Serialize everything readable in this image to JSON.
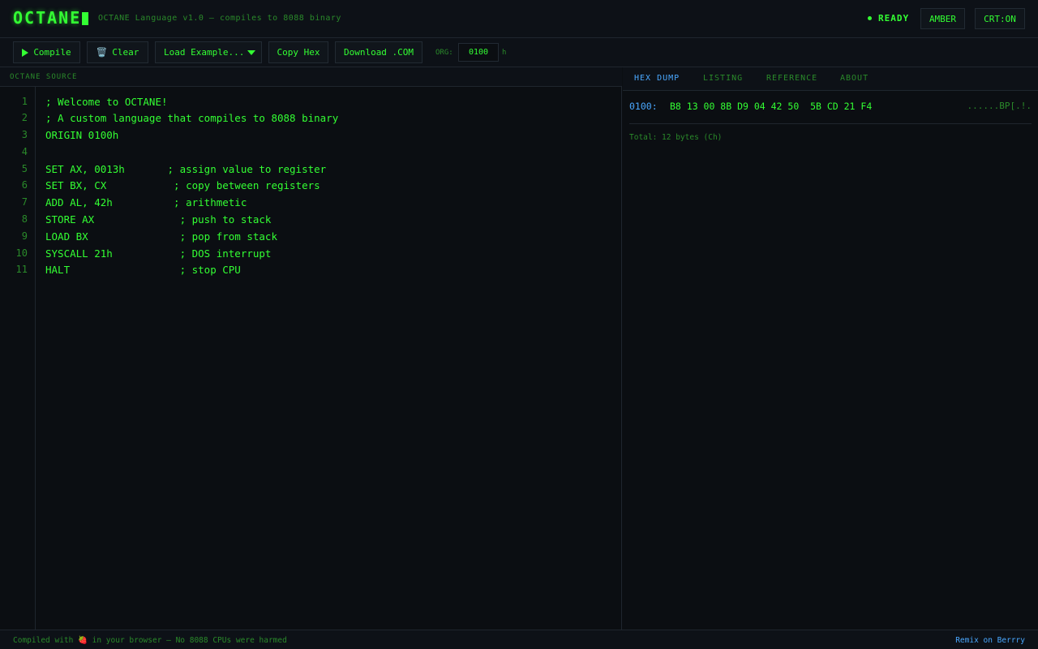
{
  "header": {
    "logo": "OCTANE",
    "subtitle": "OCTANE Language v1.0 — compiles to 8088 binary",
    "status": "READY",
    "amber_label": "AMBER",
    "crt_label": "CRT:ON"
  },
  "toolbar": {
    "compile_label": "Compile",
    "clear_label": "Clear",
    "load_example_label": "Load Example...",
    "copy_hex_label": "Copy Hex",
    "download_label": "Download .COM",
    "org_label": "ORG:",
    "org_value": "0100",
    "org_suffix": "h"
  },
  "editor": {
    "title": "OCTANE SOURCE",
    "lines": [
      "; Welcome to OCTANE!",
      "; A custom language that compiles to 8088 binary",
      "ORIGIN 0100h",
      "",
      "SET AX, 0013h       ; assign value to register",
      "SET BX, CX           ; copy between registers",
      "ADD AL, 42h          ; arithmetic",
      "STORE AX              ; push to stack",
      "LOAD BX               ; pop from stack",
      "SYSCALL 21h           ; DOS interrupt",
      "HALT                  ; stop CPU"
    ],
    "line_numbers": [
      "1",
      "2",
      "3",
      "4",
      "5",
      "6",
      "7",
      "8",
      "9",
      "10",
      "11"
    ]
  },
  "output": {
    "tabs": [
      "HEX DUMP",
      "LISTING",
      "REFERENCE",
      "ABOUT"
    ],
    "active_tab": "HEX DUMP",
    "hex_address": "0100:",
    "hex_bytes": "B8 13 00 8B D9 04 42 50  5B CD 21 F4",
    "hex_ascii": "......BP[.!.",
    "total": "Total: 12 bytes (Ch)"
  },
  "footer": {
    "text": "Compiled with 🍓 in your browser — No 8088 CPUs were harmed",
    "link": "Remix on Berrry"
  },
  "colors": {
    "background": "#0b0e12",
    "terminal_green": "#33ff33",
    "dim_green": "#2a8a2a",
    "accent_blue": "#4aa8ff"
  }
}
